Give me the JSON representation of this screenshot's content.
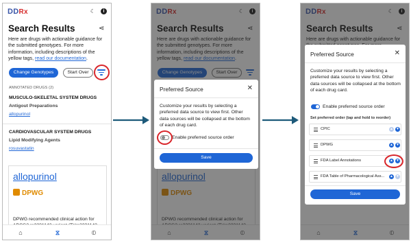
{
  "app": {
    "logo_main": "DD",
    "logo_rx": "Rx"
  },
  "icons": {
    "moon": "moon-icon",
    "info": "info-icon",
    "share": "share-icon",
    "filter": "filter-icon",
    "home": "home-icon",
    "helix": "dna-icon",
    "pills": "pills-icon",
    "close": "close-icon",
    "drag": "drag-handle-icon",
    "up": "arrow-up-icon",
    "down": "arrow-down-icon"
  },
  "colors": {
    "primary": "#1f66d6",
    "logo": "#3a56a8",
    "logo_rx": "#d62b2b",
    "dpwg": "#e08b00",
    "highlight": "#d9252a",
    "flow_arrow": "#1d5a7a"
  },
  "search": {
    "title": "Search Results",
    "desc_text": "Here are drugs with actionable guidance for the submitted genotypes. For more information, including descriptions of the yellow tags, ",
    "desc_link": "read our documentation",
    "desc_end": ".",
    "btn_change": "Change Genotypes",
    "btn_start": "Start Over"
  },
  "results": {
    "section_label": "ANNOTATED DRUGS (2)",
    "groups": [
      {
        "category": "MUSCULO-SKELETAL SYSTEM DRUGS",
        "subcategory": "Antigout Preparations",
        "drug": "allopurinol"
      },
      {
        "category": "CARDIOVASCULAR SYSTEM DRUGS",
        "subcategory": "Lipid Modifying Agents",
        "drug": "rosuvastatin"
      }
    ]
  },
  "card": {
    "drug": "allopurinol",
    "source": "DPWG",
    "text": "DPWG recommended clinical action for ABCG2 rs2231142 variant (T)/rs2231142 variant (T)"
  },
  "modal": {
    "title": "Preferred Source",
    "desc": "Customize your results by selecting a preferred data source to view first. Other data sources will be collapsed at the bottom of each drug card.",
    "toggle_label": "Enable preferred source order",
    "toggle_off": false,
    "toggle_on": true,
    "order_label": "Set preferred order (tap and hold to reorder)",
    "sources": [
      "CPIC",
      "DPWG",
      "FDA Label Annotations",
      "FDA Table of Pharmacological Ass..."
    ],
    "save": "Save"
  }
}
